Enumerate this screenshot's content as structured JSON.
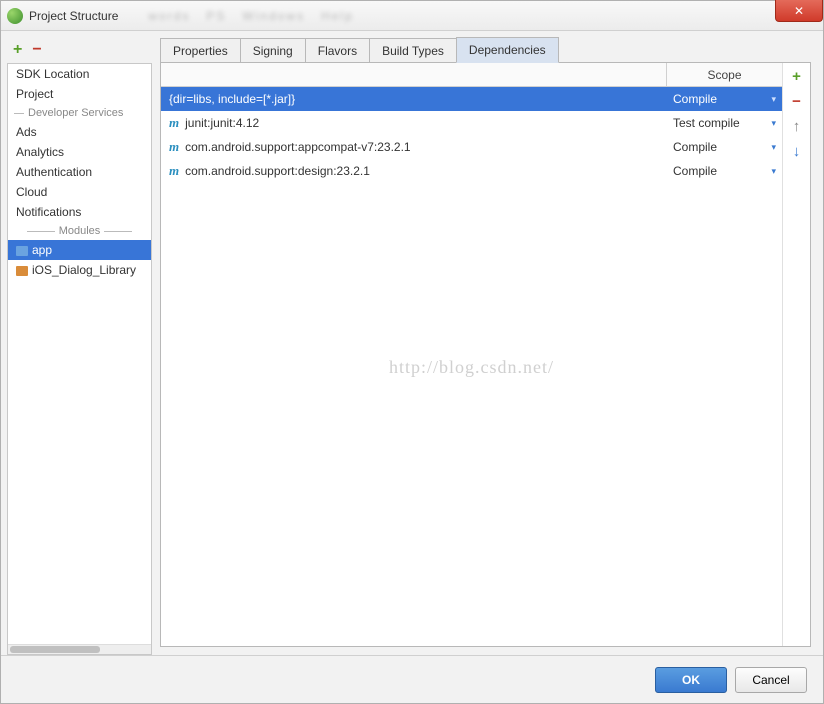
{
  "window": {
    "title": "Project Structure"
  },
  "sidebar": {
    "items_top": [
      {
        "label": "SDK Location"
      },
      {
        "label": "Project"
      }
    ],
    "section_dev": "Developer Services",
    "items_dev": [
      {
        "label": "Ads"
      },
      {
        "label": "Analytics"
      },
      {
        "label": "Authentication"
      },
      {
        "label": "Cloud"
      },
      {
        "label": "Notifications"
      }
    ],
    "section_modules": "Modules",
    "items_modules": [
      {
        "label": "app",
        "selected": true,
        "icon": "blue"
      },
      {
        "label": "iOS_Dialog_Library",
        "selected": false,
        "icon": "orange"
      }
    ]
  },
  "tabs": [
    {
      "label": "Properties",
      "active": false
    },
    {
      "label": "Signing",
      "active": false
    },
    {
      "label": "Flavors",
      "active": false
    },
    {
      "label": "Build Types",
      "active": false
    },
    {
      "label": "Dependencies",
      "active": true
    }
  ],
  "table": {
    "header_scope": "Scope",
    "rows": [
      {
        "name": "{dir=libs, include=[*.jar]}",
        "scope": "Compile",
        "selected": true,
        "icon": null
      },
      {
        "name": "junit:junit:4.12",
        "scope": "Test compile",
        "selected": false,
        "icon": "m"
      },
      {
        "name": "com.android.support:appcompat-v7:23.2.1",
        "scope": "Compile",
        "selected": false,
        "icon": "m"
      },
      {
        "name": "com.android.support:design:23.2.1",
        "scope": "Compile",
        "selected": false,
        "icon": "m"
      }
    ]
  },
  "watermark": "http://blog.csdn.net/",
  "buttons": {
    "ok": "OK",
    "cancel": "Cancel"
  }
}
